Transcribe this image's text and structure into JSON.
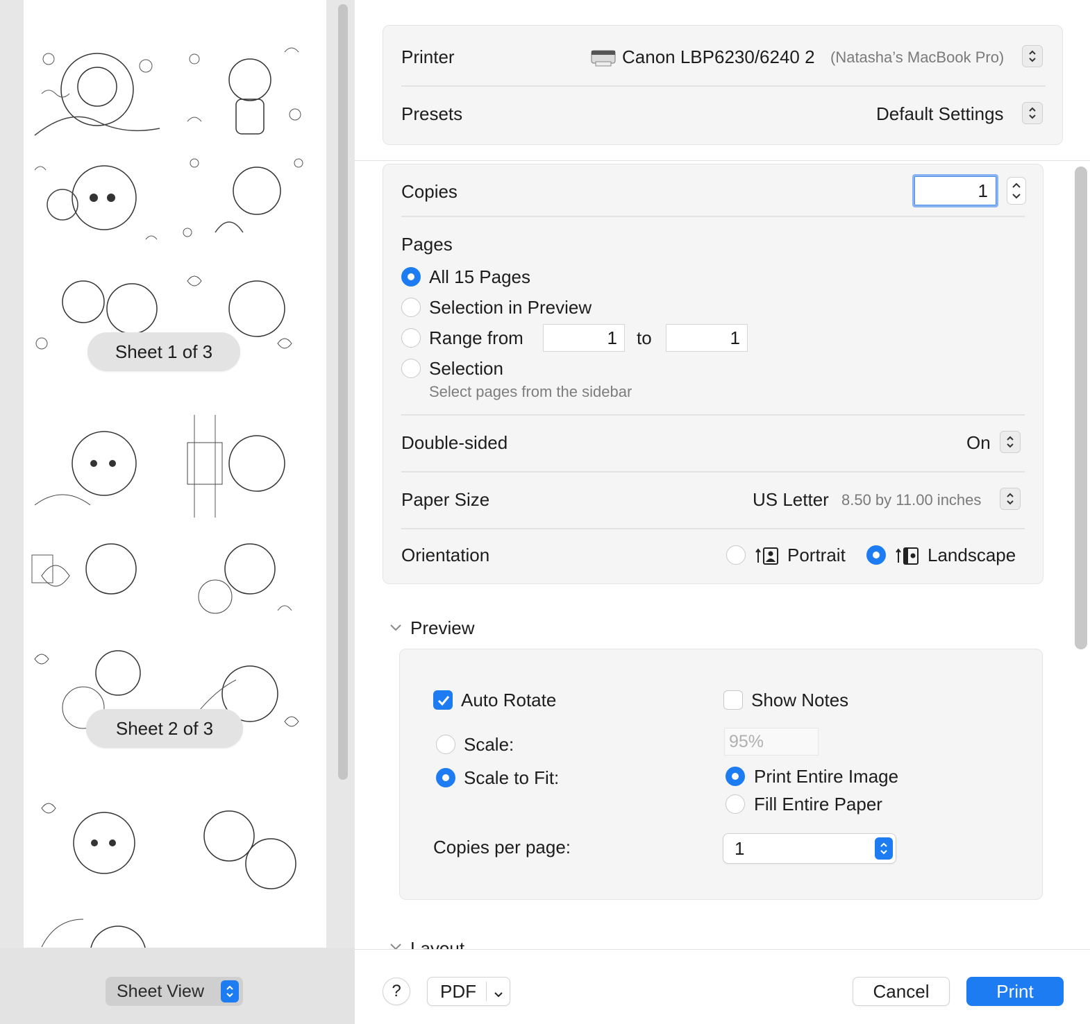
{
  "sidebar": {
    "sheets": [
      {
        "label": "Sheet 1 of 3"
      },
      {
        "label": "Sheet 2 of 3"
      },
      {
        "label": ""
      }
    ],
    "view_select": {
      "value": "Sheet View"
    }
  },
  "printer_section": {
    "printer": {
      "label": "Printer",
      "name": "Canon LBP6230/6240 2",
      "host": "(Natasha’s MacBook Pro)"
    },
    "presets": {
      "label": "Presets",
      "value": "Default Settings"
    }
  },
  "settings": {
    "copies": {
      "label": "Copies",
      "value": "1"
    },
    "pages": {
      "label": "Pages",
      "options": [
        {
          "label": "All 15 Pages",
          "selected": true
        },
        {
          "label": "Selection in Preview",
          "selected": false
        },
        {
          "label": "Range from",
          "selected": false
        },
        {
          "label": "Selection",
          "selected": false
        }
      ],
      "range_from": "1",
      "range_to_label": "to",
      "range_to": "1",
      "selection_hint": "Select pages from the sidebar"
    },
    "double_sided": {
      "label": "Double-sided",
      "value": "On"
    },
    "paper_size": {
      "label": "Paper Size",
      "value": "US Letter",
      "detail": "8.50 by 11.00 inches"
    },
    "orientation": {
      "label": "Orientation",
      "portrait": {
        "label": "Portrait",
        "selected": false
      },
      "landscape": {
        "label": "Landscape",
        "selected": true
      }
    }
  },
  "preview_section": {
    "title": "Preview",
    "auto_rotate": {
      "label": "Auto Rotate",
      "checked": true
    },
    "show_notes": {
      "label": "Show Notes",
      "checked": false
    },
    "scale": {
      "label": "Scale:",
      "value": "95%",
      "selected": false
    },
    "scale_to_fit": {
      "label": "Scale to Fit:",
      "selected": true
    },
    "print_entire_image": {
      "label": "Print Entire Image",
      "selected": true
    },
    "fill_entire_paper": {
      "label": "Fill Entire Paper",
      "selected": false
    },
    "copies_per_page": {
      "label": "Copies per page:",
      "value": "1"
    }
  },
  "layout_section": {
    "title": "Layout"
  },
  "footer": {
    "help_label": "?",
    "pdf_label": "PDF",
    "cancel_label": "Cancel",
    "print_label": "Print"
  },
  "colors": {
    "accent": "#1d7cf2",
    "panel_bg": "#f5f5f5",
    "sidebar_bg": "#e7e7e7"
  },
  "icons": [
    "printer-icon",
    "updown-chevron-icon",
    "portrait-orientation-icon",
    "landscape-orientation-icon",
    "chevron-down-icon",
    "checkmark-icon",
    "help-icon"
  ]
}
